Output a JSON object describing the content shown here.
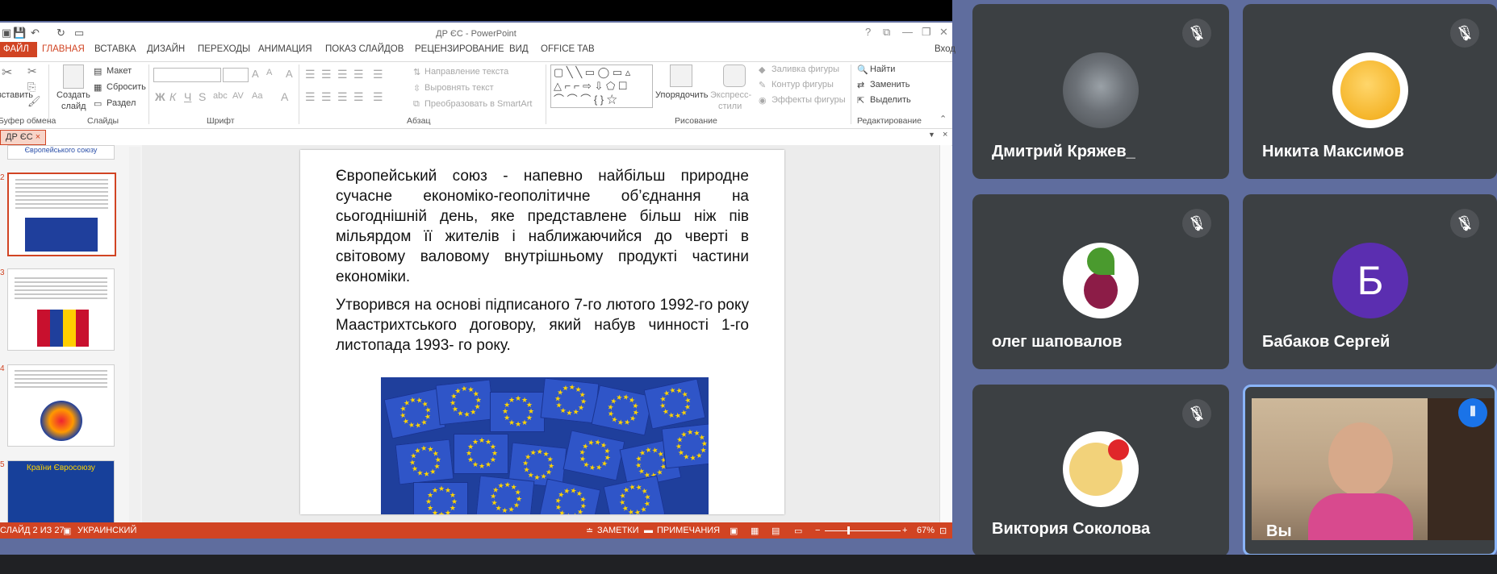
{
  "powerpoint": {
    "title": "ДР ЄС - PowerPoint",
    "tabs": [
      "ФАЙЛ",
      "ГЛАВНАЯ",
      "ВСТАВКА",
      "ДИЗАЙН",
      "ПЕРЕХОДЫ",
      "АНИМАЦИЯ",
      "ПОКАЗ СЛАЙДОВ",
      "РЕЦЕНЗИРОВАНИЕ",
      "ВИД",
      "OFFICE TAB"
    ],
    "login": "Вход",
    "ribbon": {
      "paste": "вставить",
      "create_slide": "Создать",
      "create_slide2": "слайд",
      "layout": "Макет",
      "reset": "Сбросить",
      "section": "Раздел",
      "text_direction": "Направление текста",
      "align_text": "Выровнять текст",
      "convert_smartart": "Преобразовать в SmartArt",
      "arrange": "Упорядочить",
      "express_styles": "Экспресс-",
      "express_styles2": "стили",
      "shape_fill": "Заливка фигуры",
      "shape_outline": "Контур фигуры",
      "shape_effects": "Эффекты фигуры",
      "find": "Найти",
      "replace": "Заменить",
      "select": "Выделить",
      "groups": {
        "clipboard": "Буфер обмена",
        "slides": "Слайды",
        "font": "Шрифт",
        "paragraph": "Абзац",
        "drawing": "Рисование",
        "editing": "Редактирование"
      }
    },
    "doc_tab": "ДР ЄС",
    "thumbnails": [
      {
        "num": "",
        "title": "Європейського союзу"
      },
      {
        "num": "2",
        "title": ""
      },
      {
        "num": "3",
        "title": ""
      },
      {
        "num": "4",
        "title": ""
      },
      {
        "num": "5",
        "title": "Країни Євросоюзу"
      }
    ],
    "slide": {
      "paragraph1": "Європейський союз - напевно найбільш природне сучасне економіко-геополітичне об’єднання на сьогоднішній день, яке представлене більш ніж пів мільярдом її жителів і наближаючийся до чверті в світовому валовому внутрішньому продукті частини економіки.",
      "paragraph2": "Утворився на основі підписаного 7-го лютого 1992-го року Маастрихтського договору, який набув чинності 1-го листопада 1993- го року."
    },
    "status": {
      "slide_counter": "СЛАЙД 2 ИЗ 27",
      "language": "УКРАИНСКИЙ",
      "notes": "ЗАМЕТКИ",
      "comments": "ПРИМЕЧАНИЯ",
      "zoom": "67%"
    }
  },
  "meet": {
    "participants": [
      {
        "name": "Дмитрий Кряжев_",
        "avatar": "tank-photo",
        "muted": true
      },
      {
        "name": "Никита Максимов",
        "avatar": "surprised-emoji",
        "muted": true
      },
      {
        "name": "олег шаповалов",
        "avatar": "beet-photo",
        "muted": true
      },
      {
        "name": "Бабаков Сергей",
        "avatar": "letter",
        "letter": "Б",
        "muted": true
      },
      {
        "name": "Виктория Соколова",
        "avatar": "smiley-with-flowers",
        "muted": true
      },
      {
        "name": "Вы",
        "avatar": "camera-video",
        "muted": false,
        "speaking": true
      }
    ],
    "colors": {
      "tile": "#3c4043",
      "letter_avatar": "#5b2eb0",
      "active_border": "#8ab4f8",
      "speaking": "#1a73e8"
    }
  }
}
